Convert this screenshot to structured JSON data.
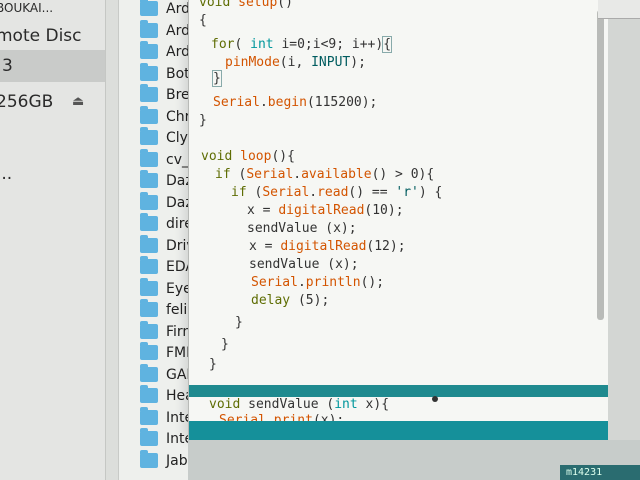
{
  "sidebar": {
    "rows": [
      {
        "label": "BOUKAI...",
        "selected": false,
        "eject": false
      },
      {
        "label": "mote Disc",
        "selected": false,
        "eject": false
      },
      {
        "label": "3",
        "selected": true,
        "eject": false
      },
      {
        "label": "256GB",
        "selected": false,
        "eject": true
      },
      {
        "label": "...",
        "selected": false,
        "eject": false
      }
    ],
    "eject_glyph": "⏏"
  },
  "filelist": {
    "items": [
      "Ard",
      "Ard",
      "Ard",
      "Bot",
      "Bre",
      "Chr",
      "Cly",
      "cv_",
      "Daz",
      "Daz",
      "dire",
      "Driv",
      "EDA",
      "Eye",
      "felic",
      "Firn",
      "FMI",
      "GAI",
      "Hea",
      "Inte",
      "Inte",
      "Jab"
    ]
  },
  "editor": {
    "lines": [
      "void setup()",
      "{",
      "  for( int i=0;i<9; i++){",
      "    pinMode(i, INPUT);",
      "  }",
      "  Serial.begin(115200);",
      "}",
      "",
      "",
      "void loop(){",
      "  if (Serial.available() > 0){",
      "    if (Serial.read() == 'r') {",
      "      x = digitalRead(10);",
      "      sendValue (x);",
      "      x = digitalRead(12);",
      "      sendValue (x);",
      "      Serial.println();",
      "      delay (5);",
      "    }",
      "  }",
      "}",
      "",
      "void sendValue (int x){",
      "  Serial.print(x);"
    ],
    "status": "m14231"
  },
  "colors": {
    "folder": "#5fb3e0",
    "keyword": "#5e6d03",
    "type": "#00979c",
    "function": "#d35400",
    "console_teal": "#15909a"
  }
}
